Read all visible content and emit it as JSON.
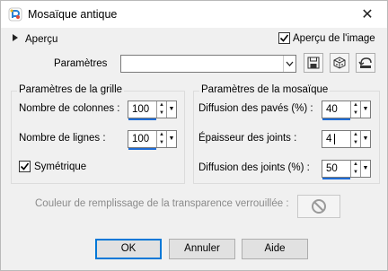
{
  "window": {
    "title": "Mosaïque antique",
    "close_glyph": "✕"
  },
  "preview": {
    "toggle_label": "Aperçu",
    "image_preview_label": "Aperçu de l'image",
    "image_preview_checked": true
  },
  "parameters": {
    "label": "Paramètres",
    "value": ""
  },
  "grid": {
    "title": "Paramètres de la grille",
    "columns_label": "Nombre de colonnes :",
    "columns_value": "100",
    "rows_label": "Nombre de lignes :",
    "rows_value": "100",
    "symmetric_label": "Symétrique",
    "symmetric_checked": true
  },
  "mosaic": {
    "title": "Paramètres de la mosaïque",
    "tile_diffusion_label": "Diffusion des pavés (%) :",
    "tile_diffusion_value": "40",
    "joint_thickness_label": "Épaisseur des joints :",
    "joint_thickness_value": "4",
    "joint_diffusion_label": "Diffusion des joints (%) :",
    "joint_diffusion_value": "50"
  },
  "fill": {
    "label": "Couleur de remplissage de la transparence verrouillée :"
  },
  "buttons": {
    "ok": "OK",
    "cancel": "Annuler",
    "help": "Aide"
  },
  "icons": {
    "app": "psp-app-icon",
    "save": "save-icon",
    "randomize": "dice-icon",
    "reset": "reset-icon",
    "no_color": "no-color-icon"
  },
  "colors": {
    "accent": "#0078d7",
    "slider_fill": "#1e6cd6"
  }
}
